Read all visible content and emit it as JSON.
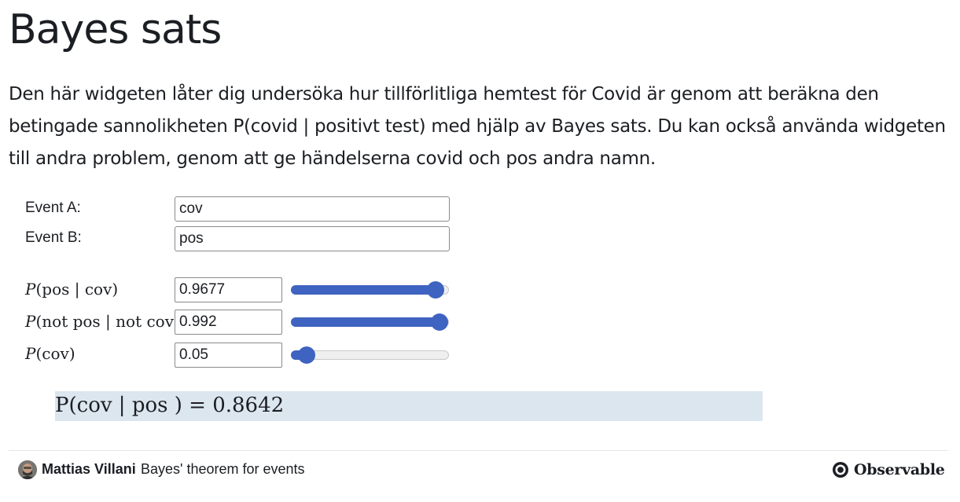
{
  "page": {
    "title": "Bayes sats",
    "intro": "Den här widgeten låter dig undersöka hur tillförlitliga hemtest för Covid är genom att beräkna den betingade sannolikheten P(covid | positivt test) med hjälp av Bayes sats. Du kan också använda widgeten till andra problem, genom att ge händelserna covid och pos andra namn."
  },
  "form": {
    "event_a_label": "Event A:",
    "event_a_value": "cov",
    "event_b_label": "Event B:",
    "event_b_value": "pos"
  },
  "probabilities": {
    "p_b_given_a": {
      "fn": "P",
      "open": "(pos | cov)",
      "value": "0.9677",
      "fraction": 0.9677
    },
    "p_notb_given_nota": {
      "fn": "P",
      "open": "(not pos | not cov)",
      "value": "0.992",
      "fraction": 0.992
    },
    "p_a": {
      "fn": "P",
      "open": "(cov)",
      "value": "0.05",
      "fraction": 0.05
    }
  },
  "result": {
    "text": "P(cov | pos ) = 0.8642"
  },
  "footer": {
    "author": "Mattias Villani",
    "notebook_title": "Bayes' theorem for events",
    "brand": "Observable"
  },
  "colors": {
    "slider_accent": "#3e63c0",
    "result_background": "#dce6ef"
  }
}
